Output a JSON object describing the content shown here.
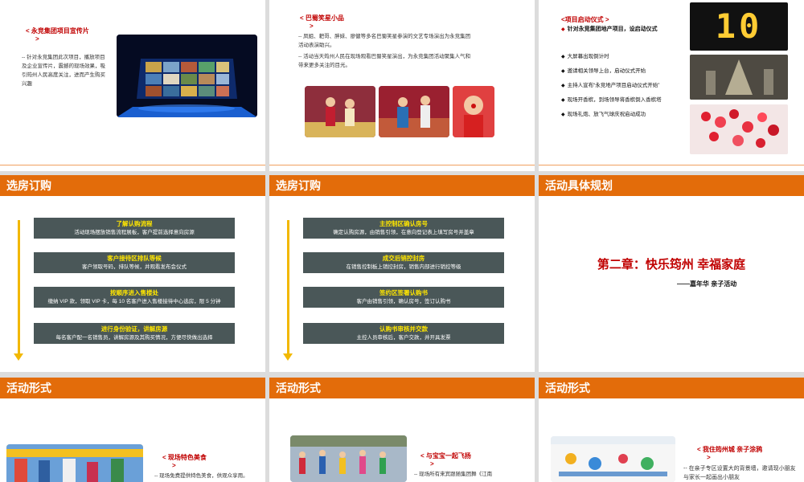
{
  "slides": {
    "s1": {
      "title": "< 永竞集团项目宣传片",
      "title_tail": ">",
      "body": "-- 针对永竞集团此次项目，播放项目及企业宣传片，震撼的现场效果，吸引筠州人民高度关注，进而产生购买兴趣"
    },
    "s2": {
      "title": "< 巴蜀笑星小品",
      "title_tail": ">",
      "body1": "-- 凤姐、耙哥、胖妹、廖健等多名巴蜀笑星参演的文艺专场演出为永竞集团活动表演助兴。",
      "body2": "-- 活动当天筠州人民在现场观看巴蜀笑星演出，为永竞集团活动聚集人气和带来更多关注的目光。"
    },
    "s3": {
      "title": "<项目启动仪式 >",
      "subtitle": "针对永竞集团地产项目，设启动仪式",
      "items": [
        "大屏幕出现倒计时",
        "邀请相关领导上台，启动仪式开始",
        "主持人宣布“永竞地产项目启动仪式开始”",
        "现场开香槟，到场领导将香槟倒入香槟塔",
        "现场礼炮、放飞气球庆祝启动成功"
      ],
      "countdown": "10"
    },
    "s4": {
      "header": "选房订购",
      "steps": [
        {
          "title": "了解认购流程",
          "desc": "活动现场摆放销售流程展板，客户提前选择意向房源"
        },
        {
          "title": "客户接待区排队等候",
          "desc": "客户领取号码，排队等候，并观看发布会仪式"
        },
        {
          "title": "按顺序进入售楼处",
          "desc": "缴纳 VIP 款，领取 VIP 卡，每 10 名客户进入售楼接待中心选房，限 5 分钟"
        },
        {
          "title": "进行身份验证，讲解房源",
          "desc": "每名客户配一名销售员，讲解房源及其购买情况，方便尽快做出选择"
        }
      ]
    },
    "s5": {
      "header": "选房订购",
      "steps": [
        {
          "title": "主控制区确认房号",
          "desc": "确定认购房源，由销售引领，在意向登记表上填写房号并盖章"
        },
        {
          "title": "成交后销控封房",
          "desc": "在销售控制板上销控封房，销售内部进行销控等级"
        },
        {
          "title": "签约区签署认购书",
          "desc": "客户由销售引领，确认房号，签订认购书"
        },
        {
          "title": "认购书审核并交款",
          "desc": "主控人员审核后，客户交款，并开具发票"
        }
      ]
    },
    "s6": {
      "header": "活动具体规划",
      "chapter": "第二章：快乐筠州  幸福家庭",
      "sub": "——嘉年华 亲子活动"
    },
    "s7": {
      "header": "活动形式",
      "title": "< 现场特色美食",
      "title_tail": ">",
      "body": "-- 现场免费提供特色美食，供观众享用。"
    },
    "s8": {
      "header": "活动形式",
      "title": "< 与宝宝一起飞扬",
      "title_tail": ">",
      "body": "-- 现场所有来宾跟随集团舞《江南"
    },
    "s9": {
      "header": "活动形式",
      "title": "< 我住筠州城  亲子涂鸦",
      "title_tail": ">",
      "body": "-- 在亲子专区设置大的背景墙，邀请现小朋友与家长一起画出小朋友"
    }
  },
  "colors": {
    "accent": "#e36c0a",
    "title_red": "#c00000",
    "step_bg": "#4a5758",
    "step_title": "#ffe600",
    "arrow": "#f2b800"
  }
}
